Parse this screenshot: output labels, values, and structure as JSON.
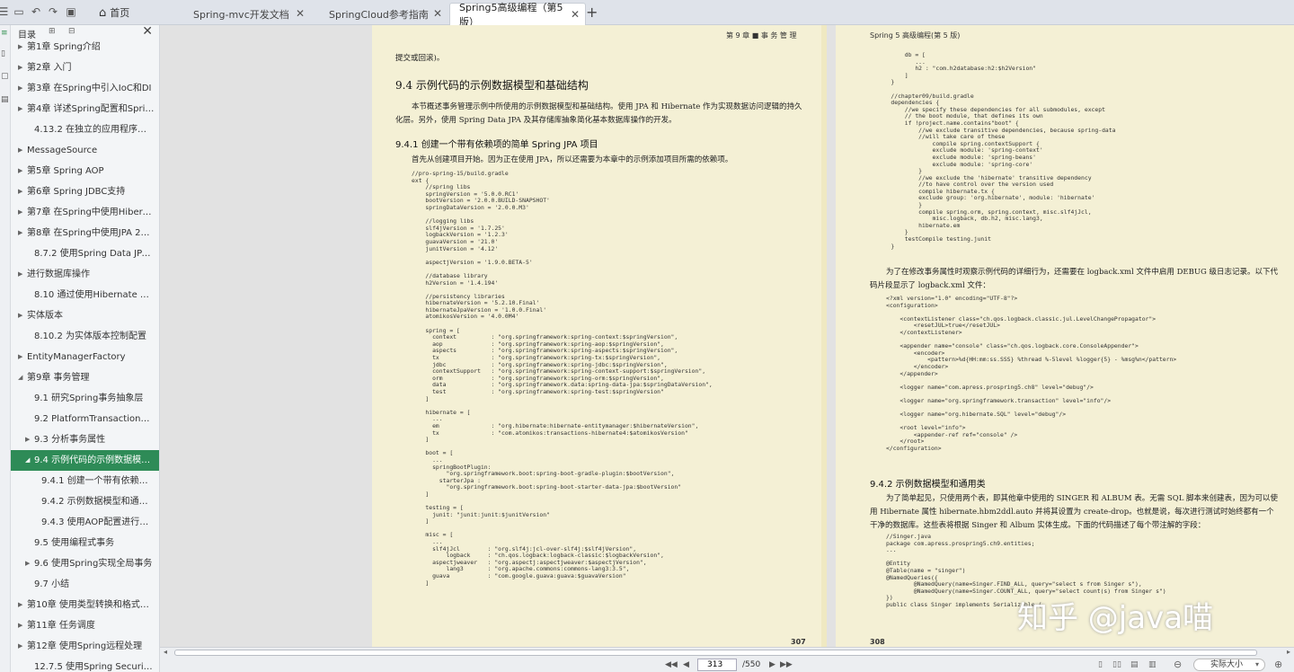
{
  "tabs": {
    "home": "首页",
    "items": [
      {
        "label": "Spring-mvc开发文档",
        "close": "✕"
      },
      {
        "label": "SpringCloud参考指南",
        "close": "✕"
      },
      {
        "label": "Spring5高级编程（第5版）",
        "close": "✕"
      }
    ],
    "new_tab": "+"
  },
  "sidebar": {
    "title": "目录",
    "close": "✕",
    "items": [
      {
        "label": "第1章 Spring介绍",
        "level": 0,
        "arrow": "▶"
      },
      {
        "label": "第2章 入门",
        "level": 0,
        "arrow": "▶"
      },
      {
        "label": "第3章 在Spring中引入IoC和DI",
        "level": 0,
        "arrow": "▶"
      },
      {
        "label": "第4章 详述Spring配置和Spring...",
        "level": 0,
        "arrow": "▶"
      },
      {
        "label": "4.13.2 在独立的应用程序中使用",
        "level": 1,
        "arrow": ""
      },
      {
        "label": "MessageSource",
        "level": 0,
        "arrow": "▶"
      },
      {
        "label": "第5章 Spring AOP",
        "level": 0,
        "arrow": "▶"
      },
      {
        "label": "第6章 Spring JDBC支持",
        "level": 0,
        "arrow": "▶"
      },
      {
        "label": "第7章 在Spring中使用Hibernate",
        "level": 0,
        "arrow": "▶"
      },
      {
        "label": "第8章 在Spring中使用JPA 2进...",
        "level": 0,
        "arrow": "▶"
      },
      {
        "label": "8.7.2 使用Spring Data JPA Re...",
        "level": 1,
        "arrow": ""
      },
      {
        "label": "进行数据库操作",
        "level": 0,
        "arrow": "▶"
      },
      {
        "label": "8.10 通过使用Hibernate Enver...",
        "level": 1,
        "arrow": ""
      },
      {
        "label": "实体版本",
        "level": 0,
        "arrow": "▶"
      },
      {
        "label": "8.10.2 为实体版本控制配置",
        "level": 1,
        "arrow": ""
      },
      {
        "label": "EntityManagerFactory",
        "level": 0,
        "arrow": "▶"
      },
      {
        "label": "第9章 事务管理",
        "level": 0,
        "arrow": "◢"
      },
      {
        "label": "9.1 研究Spring事务抽象层",
        "level": 2,
        "arrow": ""
      },
      {
        "label": "9.2 PlatformTransactionMa...",
        "level": 2,
        "arrow": ""
      },
      {
        "label": "9.3 分析事务属性",
        "level": 1,
        "arrow": "▶"
      },
      {
        "label": "9.4 示例代码的示例数据模型...",
        "level": 1,
        "arrow": "◢",
        "active": true
      },
      {
        "label": "9.4.1 创建一个带有依赖项的...",
        "level": 3,
        "arrow": ""
      },
      {
        "label": "9.4.2 示例数据模型和通用类",
        "level": 3,
        "arrow": ""
      },
      {
        "label": "9.4.3 使用AOP配置进行事务...",
        "level": 3,
        "arrow": ""
      },
      {
        "label": "9.5 使用编程式事务",
        "level": 2,
        "arrow": ""
      },
      {
        "label": "9.6 使用Spring实现全局事务",
        "level": 1,
        "arrow": "▶"
      },
      {
        "label": "9.7 小结",
        "level": 2,
        "arrow": ""
      },
      {
        "label": "第10章 使用类型转换和格式化...",
        "level": 0,
        "arrow": "▶"
      },
      {
        "label": "第11章 任务调度",
        "level": 0,
        "arrow": "▶"
      },
      {
        "label": "第12章 使用Spring远程处理",
        "level": 0,
        "arrow": "▶"
      },
      {
        "label": "12.7.5 使用Spring Security来...",
        "level": 1,
        "arrow": ""
      }
    ]
  },
  "left_page": {
    "header": "第 9 章 ■ 事 务 管 理",
    "top_text": "提交或回滚)。",
    "section_title": "9.4    示例代码的示例数据模型和基础结构",
    "section_para": "本节概述事务管理示例中所使用的示例数据模型和基础结构。使用 JPA 和 Hibernate 作为实现数据访问逻辑的持久化层。另外，使用 Spring Data JPA 及其存储库抽象简化基本数据库操作的开发。",
    "sub_title": "9.4.1   创建一个带有依赖项的简单 Spring JPA 项目",
    "sub_para": "首先从创建项目开始。因为正在使用 JPA，所以还需要为本章中的示例添加项目所需的依赖项。",
    "code": "//pro-spring-15/build.gradle\next {\n    //spring libs\n    springVersion = '5.0.0.RC1'\n    bootVersion = '2.0.0.BUILD-SNAPSHOT'\n    springDataVersion = '2.0.0.M3'\n\n    //logging libs\n    slf4jVersion = '1.7.25'\n    logbackVersion = '1.2.3'\n    guavaVersion = '21.0'\n    junitVersion = '4.12'\n\n    aspectjVersion = '1.9.0.BETA-5'\n\n    //database library\n    h2Version = '1.4.194'\n\n    //persistency libraries\n    hibernateVersion = '5.2.10.Final'\n    hibernateJpaVersion = '1.0.0.Final'\n    atomikosVersion = '4.0.0M4'\n\n    spring = [\n      context          : \"org.springframework:spring-context:$springVersion\",\n      aop              : \"org.springframework:spring-aop:$springVersion\",\n      aspects          : \"org.springframework:spring-aspects:$springVersion\",\n      tx               : \"org.springframework:spring-tx:$springVersion\",\n      jdbc             : \"org.springframework:spring-jdbc:$springVersion\",\n      contextSupport   : \"org.springframework:spring-context-support:$springVersion\",\n      orm              : \"org.springframework:spring-orm:$springVersion\",\n      data             : \"org.springframework.data:spring-data-jpa:$springDataVersion\",\n      test             : \"org.springframework:spring-test:$springVersion\"\n    ]\n\n    hibernate = [\n      ...\n      em               : \"org.hibernate:hibernate-entitymanager:$hibernateVersion\",\n      tx               : \"com.atomikos:transactions-hibernate4:$atomikosVersion\"\n    ]\n\n    boot = [\n      ...\n      springBootPlugin:\n          \"org.springframework.boot:spring-boot-gradle-plugin:$bootVersion\",\n        starterJpa :\n          \"org.springframework.boot:spring-boot-starter-data-jpa:$bootVersion\"\n    ]\n\n    testing = [\n      junit: \"junit:junit:$junitVersion\"\n    ]\n\n    misc = [\n      ...\n      slf4jJcl        : \"org.slf4j:jcl-over-slf4j:$slf4jVersion\",\n          logback     : \"ch.qos.logback:logback-classic:$logbackVersion\",\n      aspectjweaver   : \"org.aspectj:aspectjweaver:$aspectjVersion\",\n          lang3       : \"org.apache.commons:commons-lang3:3.5\",\n      guava           : \"com.google.guava:guava:$guavaVersion\"\n    ]",
    "page_number": "307"
  },
  "right_page": {
    "header": "Spring 5 高级编程(第 5 版)",
    "code1": "        db = [\n           ...\n           h2 : \"com.h2database:h2:$h2Version\"\n        ]\n    }\n\n    //chapter09/build.gradle\n    dependencies {\n        //we specify these dependencies for all submodules, except\n        // the boot module, that defines its own\n        if !project.name.contains\"boot\" {\n            //we exclude transitive dependencies, because spring-data\n            //will take care of these\n                compile spring.contextSupport {\n                exclude module: 'spring-context'\n                exclude module: 'spring-beans'\n                exclude module: 'spring-core'\n            }\n            //we exclude the 'hibernate' transitive dependency\n            //to have control over the version used\n            compile hibernate.tx {\n            exclude group: 'org.hibernate', module: 'hibernate'\n            }\n            compile spring.orm, spring.context, misc.slf4jJcl,\n                misc.logback, db.h2, misc.lang3,\n            hibernate.em\n        }\n        testCompile testing.junit\n    }",
    "para1": "为了在修改事务属性时观察示例代码的详细行为，还需要在 logback.xml 文件中启用 DEBUG 级日志记录。以下代码片段显示了 logback.xml 文件：",
    "code2": "<?xml version=\"1.0\" encoding=\"UTF-8\"?>\n<configuration>\n\n    <contextListener class=\"ch.qos.logback.classic.jul.LevelChangePropagator\">\n        <resetJUL>true</resetJUL>\n    </contextListener>\n\n    <appender name=\"console\" class=\"ch.qos.logback.core.ConsoleAppender\">\n        <encoder>\n            <pattern>%d{HH:mm:ss.SSS} %thread %-5level %logger{5} - %msg%n</pattern>\n        </encoder>\n    </appender>\n\n    <logger name=\"com.apress.prospring5.ch8\" level=\"debug\"/>\n\n    <logger name=\"org.springframework.transaction\" level=\"info\"/>\n\n    <logger name=\"org.hibernate.SQL\" level=\"debug\"/>\n\n    <root level=\"info\">\n        <appender-ref ref=\"console\" />\n    </root>\n</configuration>",
    "sub_title": "9.4.2   示例数据模型和通用类",
    "para2": "为了简单起见，只使用两个表，即其他章中使用的 SINGER 和 ALBUM 表。无需 SQL 脚本来创建表，因为可以使用 Hibernate 属性 hibernate.hbm2ddl.auto 并将其设置为 create-drop。也就是说，每次进行测试时始终都有一个干净的数据库。这些表将根据 Singer 和 Album 实体生成。下面的代码描述了每个带注解的字段：",
    "code3": "//Singer.java\npackage com.apress.prospring5.ch9.entities;\n...\n\n@Entity\n@Table(name = \"singer\")\n@NamedQueries({\n        @NamedQuery(name=Singer.FIND_ALL, query=\"select s from Singer s\"),\n        @NamedQuery(name=Singer.COUNT_ALL, query=\"select count(s) from Singer s\")\n})\npublic class Singer implements Serializable {",
    "page_number": "308"
  },
  "watermark": "知乎 @java喵",
  "statusbar": {
    "current_page": "313",
    "total": "/550",
    "zoom": "实际大小"
  },
  "icons": {
    "new": "☰",
    "open": "📂",
    "undo": "↶",
    "redo": "↷",
    "save": "▣",
    "home": "⌂"
  }
}
